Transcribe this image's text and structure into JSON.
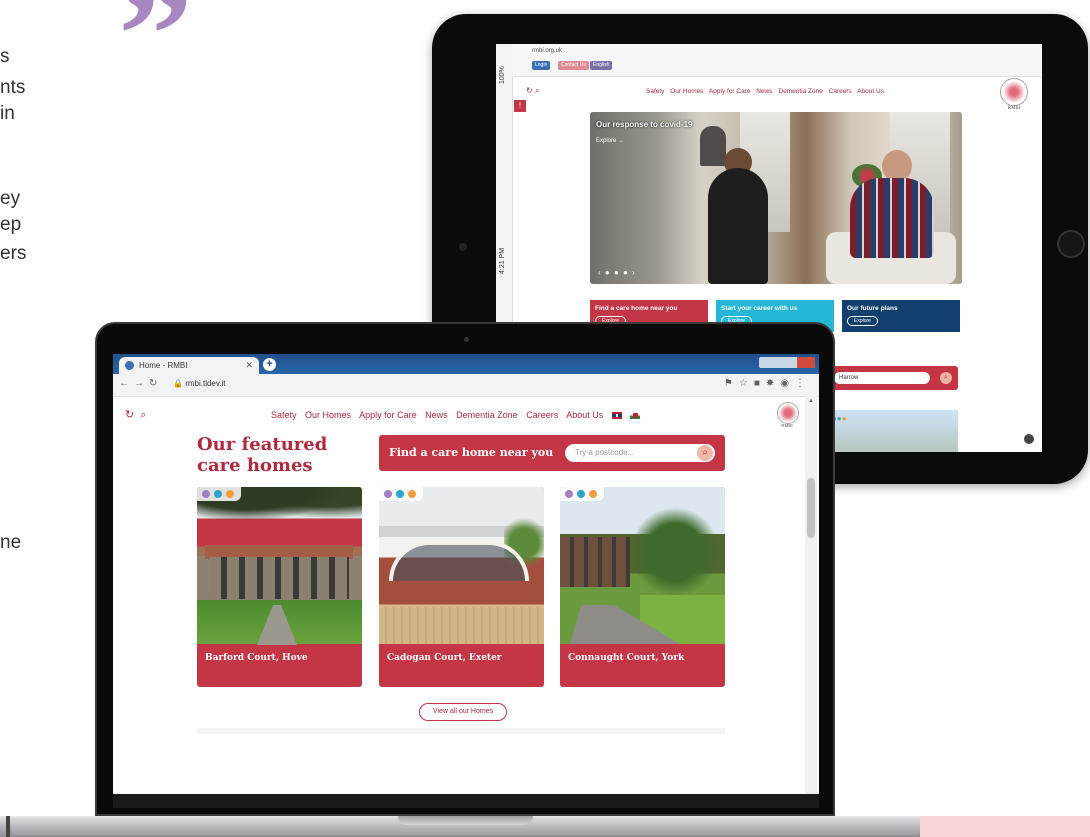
{
  "left_text": {
    "lines": [
      "s",
      "nts",
      "in",
      "ey",
      "ep",
      "ers",
      "ne"
    ]
  },
  "quote_mark": "”",
  "tablet": {
    "status": {
      "battery": "100%",
      "time": "4:21 PM"
    },
    "url": "rmbi.org.uk",
    "pills": [
      "Login",
      "Contact Us",
      "English"
    ],
    "nav": [
      "Safety",
      "Our Homes",
      "Apply for Care",
      "News",
      "Dementia Zone",
      "Careers",
      "About Us"
    ],
    "logo_text": "RMBI",
    "hero": {
      "title": "Our response to covid-19",
      "explore": "Explore →",
      "dots": "‹ ● ● ● ›"
    },
    "cards": [
      {
        "label": "Find a care home near you",
        "button": "Explore",
        "color": "#c43646"
      },
      {
        "label": "Start your career with us",
        "button": "Explore",
        "color": "#25b6d8"
      },
      {
        "label": "Our future plans",
        "button": "Explore",
        "color": "#123f6d"
      }
    ],
    "search_value": "Harrow"
  },
  "laptop": {
    "tab_title": "Home - RMBI",
    "url": "rmbi.tldev.it",
    "nav": [
      "Safety",
      "Our Homes",
      "Apply for Care",
      "News",
      "Dementia Zone",
      "Careers",
      "About Us"
    ],
    "logo_text": "RMBI",
    "featured_title": "Our featured care homes",
    "search_label": "Find a care home near you",
    "search_placeholder": "Try a postcode...",
    "homes": [
      {
        "name": "Barford Court, Hove"
      },
      {
        "name": "Cadogan Court, Exeter"
      },
      {
        "name": "Connaught Court, York"
      }
    ],
    "view_all": "View all our Homes"
  },
  "colors": {
    "brand_red": "#c43646",
    "brand_text": "#b2293c",
    "quote": "#a786c2",
    "dot_purple": "#a47fc6",
    "dot_teal": "#2aa6c9",
    "dot_orange": "#f29e3a"
  }
}
